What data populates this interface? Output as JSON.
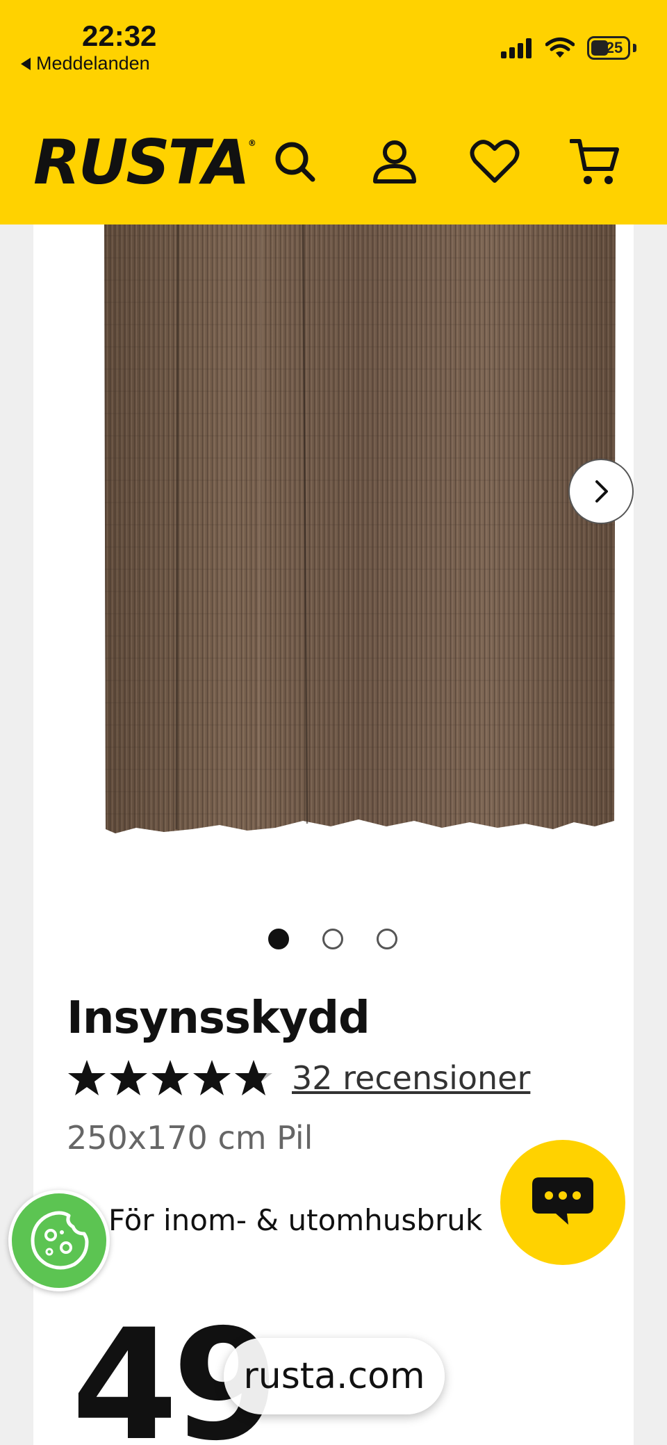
{
  "status_bar": {
    "time": "22:32",
    "back_label": "Meddelanden",
    "battery": "25"
  },
  "header": {
    "logo": "RUSTA",
    "icons": [
      "search-icon",
      "user-icon",
      "heart-icon",
      "cart-icon"
    ],
    "background": "#ffd200"
  },
  "gallery": {
    "image_alt": "Insynsskydd pil",
    "slides": 3,
    "active_slide": 1
  },
  "product": {
    "title": "Insynsskydd",
    "rating": 5,
    "reviews_label": "32 recensioner",
    "size": "250x170 cm Pil",
    "feature": "För inom- & utomhusbruk",
    "price": "49"
  },
  "browser": {
    "url": "rusta.com"
  }
}
